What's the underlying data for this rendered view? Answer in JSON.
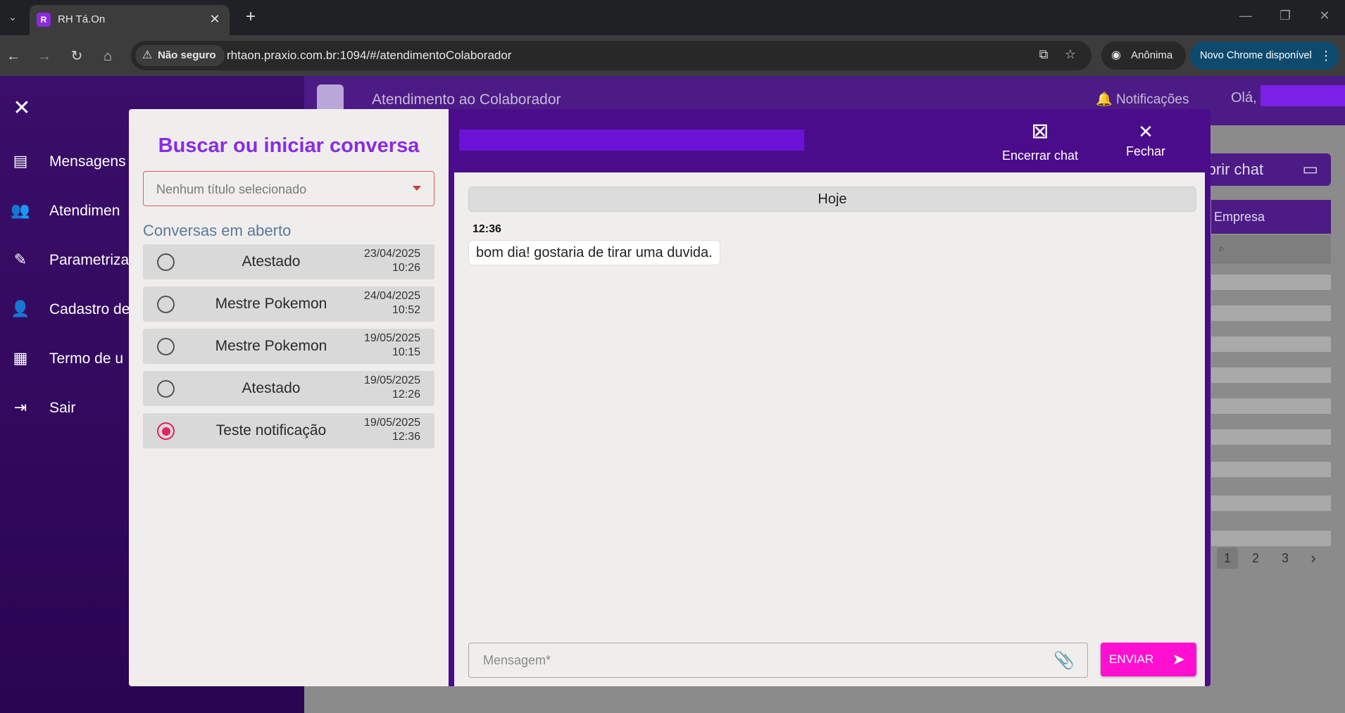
{
  "browser": {
    "tab_title": "RH Tá.On",
    "tab_favicon_letter": "R",
    "security_label": "Não seguro",
    "url": "rhtaon.praxio.com.br:1094/#/atendimentoColaborador",
    "incognito_label": "Anônima",
    "update_label": "Novo Chrome disponível"
  },
  "sidebar": {
    "items": [
      {
        "label": "Mensagens",
        "icon": "message-icon"
      },
      {
        "label": "Atendimen",
        "icon": "support-icon"
      },
      {
        "label": "Parametriza",
        "icon": "pencil-icon"
      },
      {
        "label": "Cadastro de",
        "icon": "add-user-icon"
      },
      {
        "label": "Termo de u",
        "icon": "document-icon"
      },
      {
        "label": "Sair",
        "icon": "logout-icon"
      }
    ]
  },
  "app_header": {
    "title": "Atendimento ao Colaborador",
    "notifications_label": "Notificações",
    "greeting": "Olá, :"
  },
  "content": {
    "open_chat_label": "Abrir chat",
    "table_header": "Empresa",
    "pages": [
      "1",
      "2",
      "3"
    ],
    "active_page": "1"
  },
  "chat_modal": {
    "left": {
      "title": "Buscar ou iniciar conversa",
      "select_placeholder": "Nenhum título selecionado",
      "section_title": "Conversas em aberto",
      "conversations": [
        {
          "title": "Atestado",
          "date": "23/04/2025",
          "time": "10:26",
          "selected": false
        },
        {
          "title": "Mestre Pokemon",
          "date": "24/04/2025",
          "time": "10:52",
          "selected": false
        },
        {
          "title": "Mestre Pokemon",
          "date": "19/05/2025",
          "time": "10:15",
          "selected": false
        },
        {
          "title": "Atestado",
          "date": "19/05/2025",
          "time": "12:26",
          "selected": false
        },
        {
          "title": "Teste notificação",
          "date": "19/05/2025",
          "time": "12:36",
          "selected": true
        }
      ]
    },
    "right": {
      "end_chat_label": "Encerrar chat",
      "close_label": "Fechar",
      "day_label": "Hoje",
      "messages": [
        {
          "time": "12:36",
          "text": "bom dia! gostaria de tirar uma duvida."
        }
      ],
      "input_placeholder": "Mensagem*",
      "send_label": "ENVIAR"
    }
  },
  "colors": {
    "accent_purple": "#8a2be2",
    "header_purple": "#4a0c8a",
    "send_pink": "#ff10d0",
    "radio_selected": "#e0245e"
  }
}
